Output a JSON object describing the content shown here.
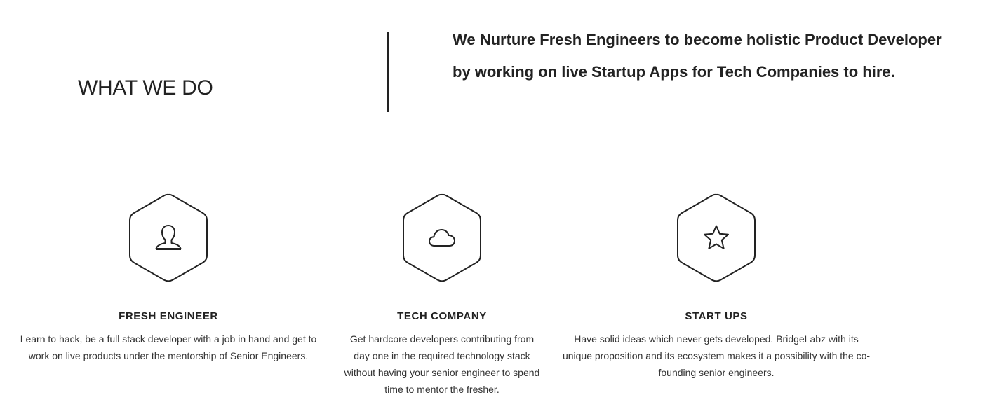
{
  "section": {
    "title": "WHAT WE DO",
    "tagline_lines": [
      "We Nurture Fresh Engineers to become holistic Product Developer",
      "by working on live Startup Apps for Tech Companies to hire."
    ]
  },
  "features": [
    {
      "icon": "user-icon",
      "title": "FRESH ENGINEER",
      "desc_lines": [
        "Learn to hack, be a full stack developer with a job in hand and get to",
        "work on live products under the mentorship of Senior Engineers."
      ]
    },
    {
      "icon": "cloud-icon",
      "title": "TECH COMPANY",
      "desc_lines": [
        "Get hardcore developers contributing from",
        "day one in the required technology stack",
        "without having your senior engineer to spend",
        "time to mentor the fresher."
      ]
    },
    {
      "icon": "star-icon",
      "title": "START UPS",
      "desc_lines": [
        "Have solid ideas which never gets developed. BridgeLabz with its",
        "unique proposition and its ecosystem makes it a possibility with the co-",
        "founding senior engineers."
      ]
    }
  ],
  "colors": {
    "text": "#222222",
    "body_text": "#333333",
    "background": "#ffffff"
  }
}
